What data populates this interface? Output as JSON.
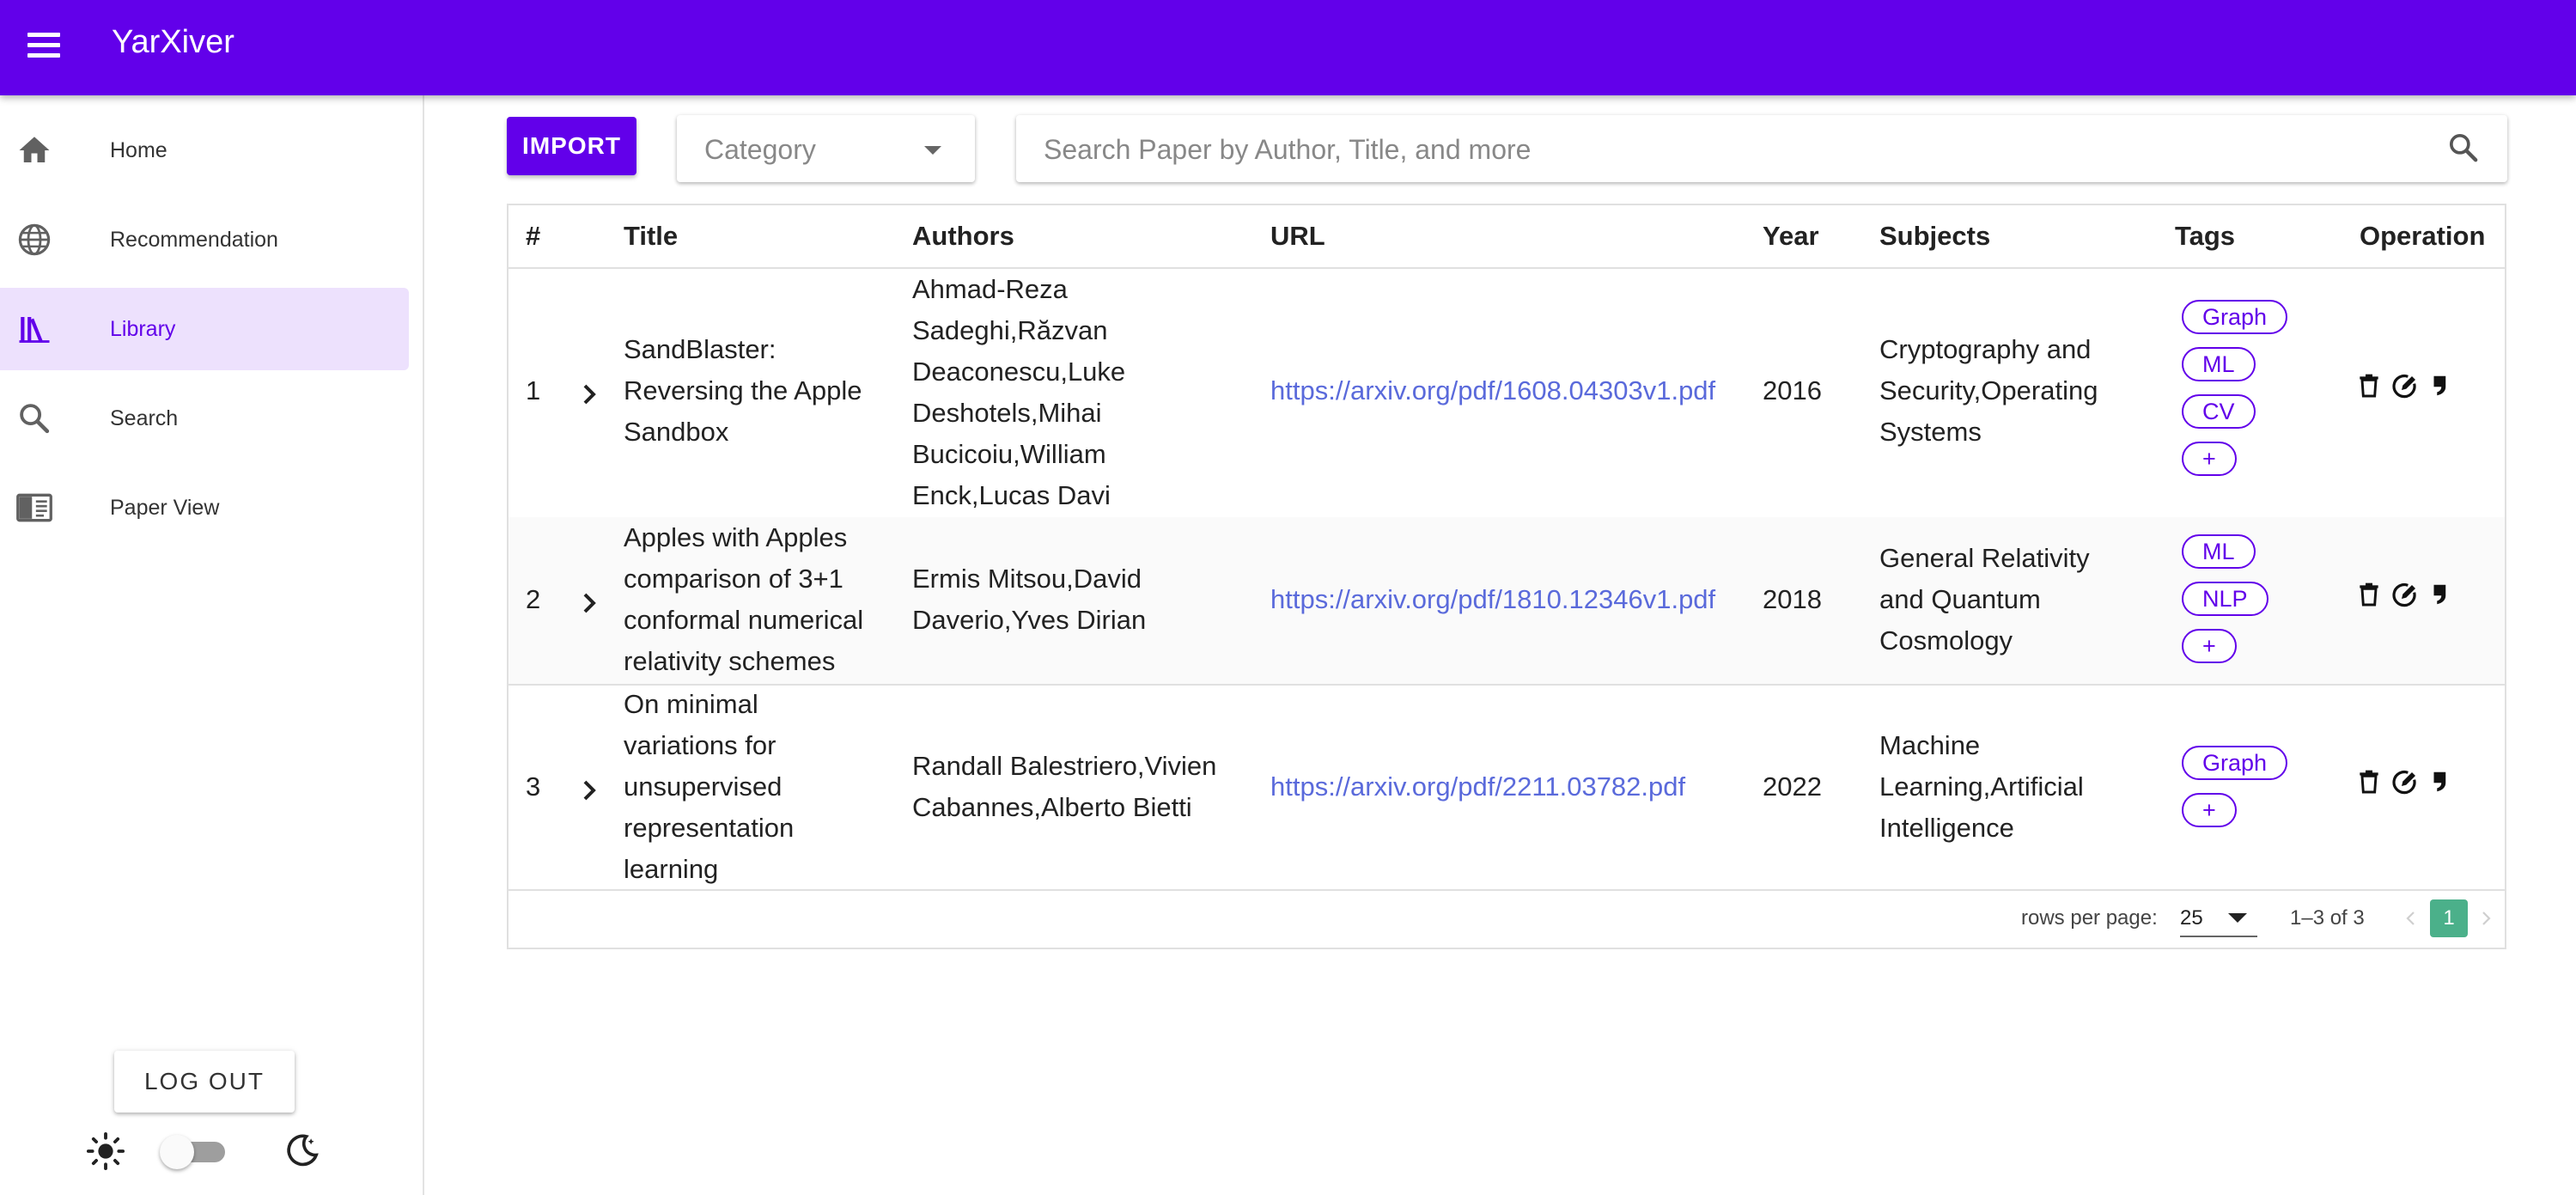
{
  "app": {
    "title": "YarXiver"
  },
  "sidebar": {
    "items": [
      {
        "label": "Home",
        "icon": "home-icon"
      },
      {
        "label": "Recommendation",
        "icon": "globe-icon"
      },
      {
        "label": "Library",
        "icon": "library-icon",
        "active": true
      },
      {
        "label": "Search",
        "icon": "search-icon"
      },
      {
        "label": "Paper View",
        "icon": "paper-view-icon"
      }
    ],
    "logout_label": "LOG OUT",
    "theme": {
      "dark_mode": false,
      "light_icon": "sun-icon",
      "dark_icon": "moon-icon"
    }
  },
  "toolbar": {
    "import_label": "IMPORT",
    "category_placeholder": "Category",
    "search_placeholder": "Search Paper by Author, Title, and more"
  },
  "table": {
    "headers": [
      "#",
      "Title",
      "Authors",
      "URL",
      "Year",
      "Subjects",
      "Tags",
      "Operation"
    ],
    "rows": [
      {
        "index": "1",
        "title": "SandBlaster: Reversing the Apple Sandbox",
        "authors": "Ahmad-Reza Sadeghi,Răzvan Deaconescu,Luke Deshotels,Mihai Bucicoiu,William Enck,Lucas Davi",
        "url": "https://arxiv.org/pdf/1608.04303v1.pdf",
        "year": "2016",
        "subjects": "Cryptography and Security,Operating Systems",
        "tags": [
          "Graph",
          "ML",
          "CV"
        ],
        "add_tag": "+"
      },
      {
        "index": "2",
        "title": "Apples with Apples comparison of 3+1 conformal numerical relativity schemes",
        "authors": "Ermis Mitsou,David Daverio,Yves Dirian",
        "url": "https://arxiv.org/pdf/1810.12346v1.pdf",
        "year": "2018",
        "subjects": "General Relativity and Quantum Cosmology",
        "tags": [
          "ML",
          "NLP"
        ],
        "add_tag": "+"
      },
      {
        "index": "3",
        "title": "On minimal variations for unsupervised representation learning",
        "authors": "Randall Balestriero,Vivien Cabannes,Alberto Bietti",
        "url": "https://arxiv.org/pdf/2211.03782.pdf",
        "year": "2022",
        "subjects": "Machine Learning,Artificial Intelligence",
        "tags": [
          "Graph"
        ],
        "add_tag": "+"
      }
    ],
    "operations": [
      "delete-icon",
      "edit-icon",
      "quote-icon"
    ],
    "footer": {
      "rows_per_page_label": "rows per page:",
      "rows_per_page_value": "25",
      "range_label": "1–3 of 3",
      "current_page": "1"
    }
  },
  "colors": {
    "primary": "#6200ea",
    "active_bg": "#ede1fd",
    "link": "#5a6adb",
    "page_active": "#4bb08a"
  }
}
